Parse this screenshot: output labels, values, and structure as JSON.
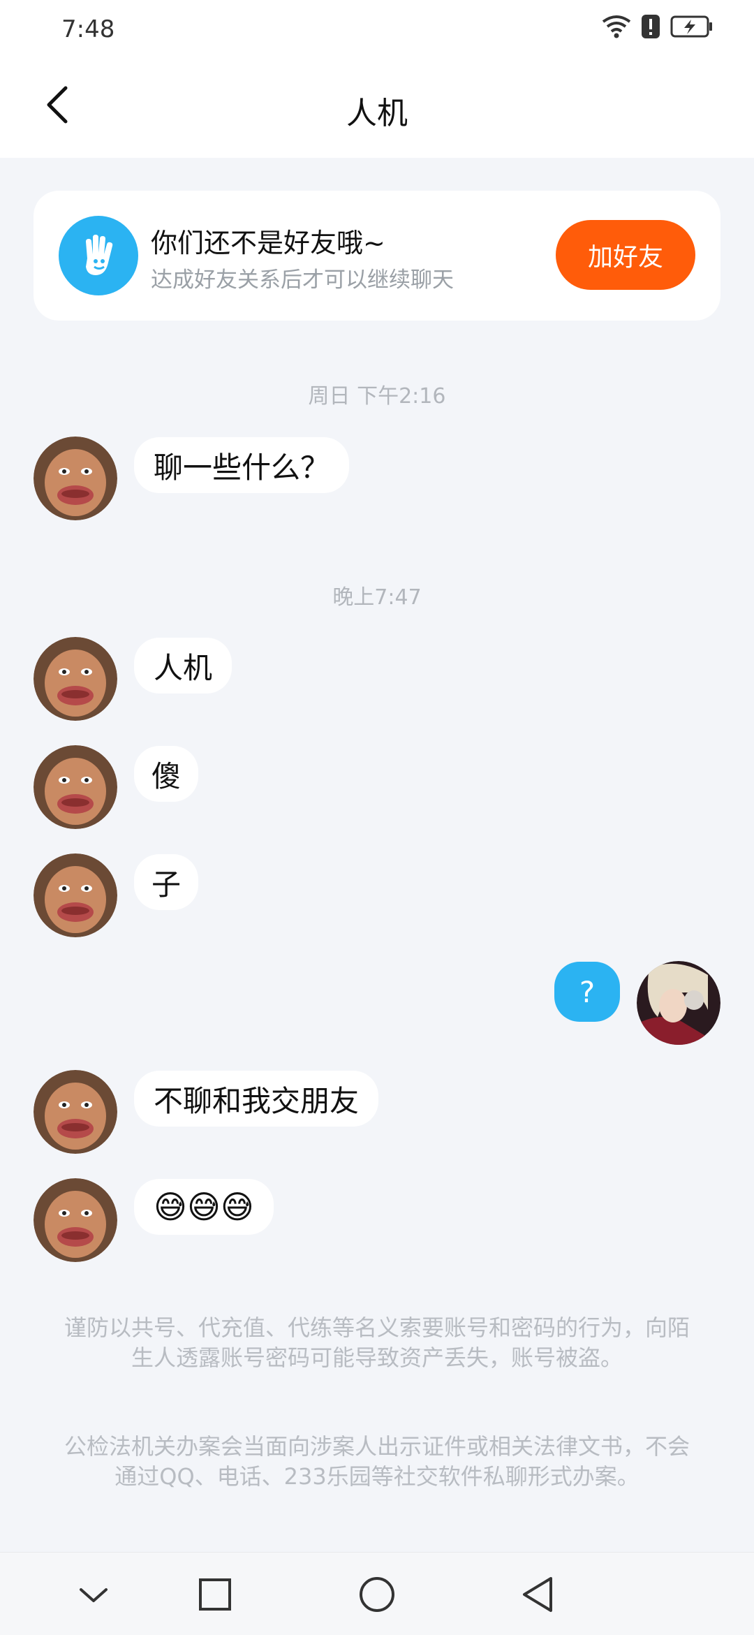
{
  "status": {
    "time": "7:48"
  },
  "header": {
    "title": "人机",
    "back_icon": "chevron-left-icon"
  },
  "friend_notice": {
    "title": "你们还不是好友哦~",
    "subtitle": "达成好友关系后才可以继续聊天",
    "button": "加好友",
    "button_color": "#ff5c0a"
  },
  "chat": {
    "timestamps": [
      "周日 下午2:16",
      "晚上7:47"
    ],
    "messages": [
      {
        "side": "left",
        "text": "聊一些什么？"
      },
      {
        "side": "left",
        "text": "人机"
      },
      {
        "side": "left",
        "text": "傻"
      },
      {
        "side": "left",
        "text": "子"
      },
      {
        "side": "right",
        "text": "?"
      },
      {
        "side": "left",
        "text": "不聊和我交朋友"
      },
      {
        "side": "left",
        "text": "😅😅😅"
      }
    ]
  },
  "notices": [
    "谨防以共号、代充值、代练等名义索要账号和密码的行为，向陌生人透露账号密码可能导致资产丢失，账号被盗。",
    "公检法机关办案会当面向涉案人出示证件或相关法律文书，不会通过QQ、电话、233乐园等社交软件私聊形式办案。"
  ],
  "nav": {
    "items": [
      "chevron-down-icon",
      "square-icon",
      "circle-icon",
      "triangle-back-icon"
    ]
  },
  "colors": {
    "accent_blue": "#2bb3f2",
    "background": "#f3f5f9"
  }
}
